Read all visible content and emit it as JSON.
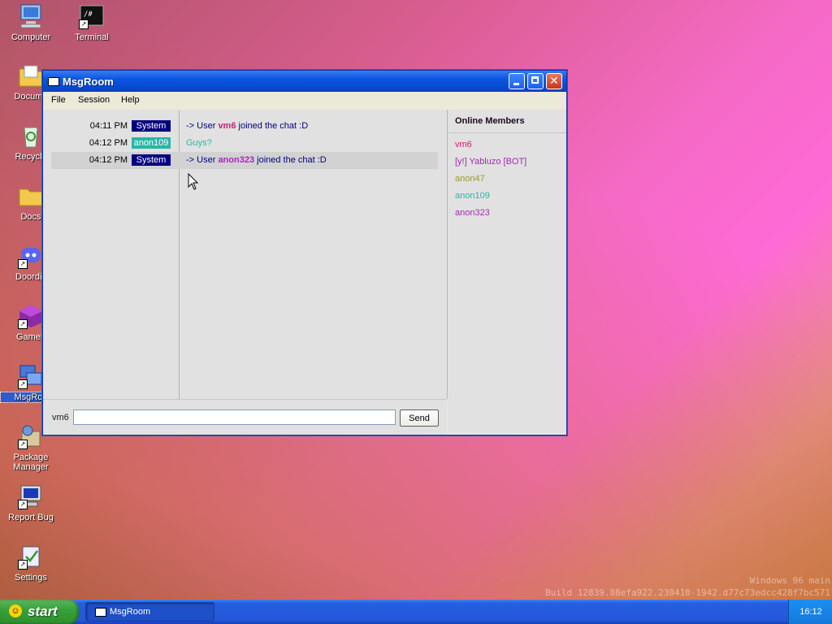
{
  "desktop": {
    "icons": [
      {
        "label": "Computer",
        "icon": "computer-icon"
      },
      {
        "label": "Terminal",
        "icon": "terminal-icon"
      },
      {
        "label": "Docume",
        "icon": "documents-icon"
      },
      {
        "label": "Recycle",
        "icon": "recycle-bin-icon"
      },
      {
        "label": "Docs",
        "icon": "folder-icon"
      },
      {
        "label": "Doordis",
        "icon": "doordis-icon"
      },
      {
        "label": "Gameir",
        "icon": "game-icon"
      },
      {
        "label": "MsgRoo",
        "icon": "msgroom-icon"
      },
      {
        "label": "Package Manager",
        "icon": "package-icon"
      },
      {
        "label": "Report Bug",
        "icon": "report-bug-icon"
      },
      {
        "label": "Settings",
        "icon": "settings-icon"
      }
    ],
    "watermark": {
      "line1": "Windows 96 main",
      "line2": "Build 12839.88efa922.230410-1942.d77c73edcc428f7bc571"
    }
  },
  "window": {
    "title": "MsgRoom",
    "menu": [
      "File",
      "Session",
      "Help"
    ],
    "messages": [
      {
        "time": "04:11 PM",
        "user": "System",
        "user_color": "#000080",
        "prefix": "-> User ",
        "nick": "vm6",
        "nick_color": "#cc1e6e",
        "suffix": " joined the chat :D",
        "text_color": "#000080",
        "highlighted": false
      },
      {
        "time": "04:12 PM",
        "user": "anon109",
        "user_color": "#2ab6a6",
        "prefix": "Guys?",
        "nick": "",
        "nick_color": "#2ab6a6",
        "suffix": "",
        "text_color": "#2ab6a6",
        "highlighted": false
      },
      {
        "time": "04:12 PM",
        "user": "System",
        "user_color": "#000080",
        "prefix": "-> User ",
        "nick": "anon323",
        "nick_color": "#a52ab6",
        "suffix": " joined the chat :D",
        "text_color": "#000080",
        "highlighted": true
      }
    ],
    "members_heading": "Online Members",
    "members": [
      {
        "name": "vm6",
        "color": "#cc1e6e"
      },
      {
        "name": "[y!] Yabluzo [BOT]",
        "color": "#a02ab0"
      },
      {
        "name": "anon47",
        "color": "#9a9a2a"
      },
      {
        "name": "anon109",
        "color": "#2ab6a6"
      },
      {
        "name": "anon323",
        "color": "#a52ab6"
      }
    ],
    "input": {
      "nick_label": "vm6",
      "value": "",
      "send_label": "Send"
    }
  },
  "taskbar": {
    "start_label": "start",
    "tasks": [
      {
        "label": "MsgRoom"
      }
    ],
    "clock": "16:12"
  }
}
